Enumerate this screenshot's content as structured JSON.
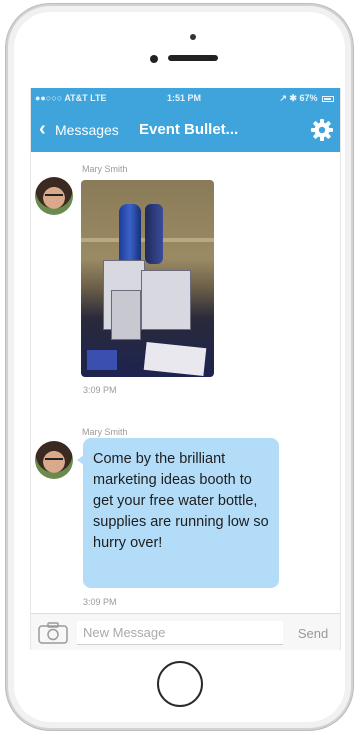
{
  "status_bar": {
    "carrier": "●●○○○ AT&T  LTE",
    "time": "1:51 PM",
    "battery": "↗ ✱ 67%"
  },
  "nav": {
    "back_label": "Messages",
    "title": "Event Bullet...",
    "back_icon": "chevron-left-icon",
    "settings_icon": "gear-icon"
  },
  "messages": [
    {
      "sender": "Mary Smith",
      "type": "image",
      "time": "3:09 PM"
    },
    {
      "sender": "Mary Smith",
      "type": "text",
      "text": "Come by the brilliant marketing ideas booth to get your free water bottle, supplies are running low so hurry over!",
      "time": "3:09 PM"
    }
  ],
  "composer": {
    "placeholder": "New Message",
    "value": "",
    "send_label": "Send",
    "camera_icon": "camera-icon"
  },
  "colors": {
    "accent": "#3fa4dc",
    "bubble": "#b3dcf8"
  }
}
